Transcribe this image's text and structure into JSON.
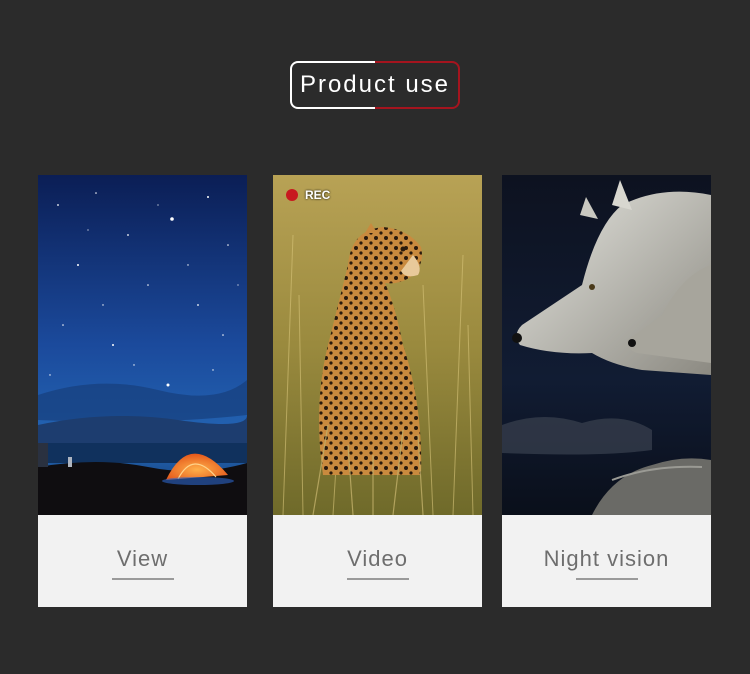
{
  "header": {
    "title": "Product use"
  },
  "cards": [
    {
      "label": "View",
      "image": "starry-night-camping-tent"
    },
    {
      "label": "Video",
      "image": "cheetah-in-grass",
      "badge": "REC"
    },
    {
      "label": "Night vision",
      "image": "wolves-at-night"
    }
  ],
  "colors": {
    "background": "#2b2b2b",
    "accent": "#a5141e",
    "card": "#f2f2f2",
    "rec_dot": "#c8191f"
  }
}
